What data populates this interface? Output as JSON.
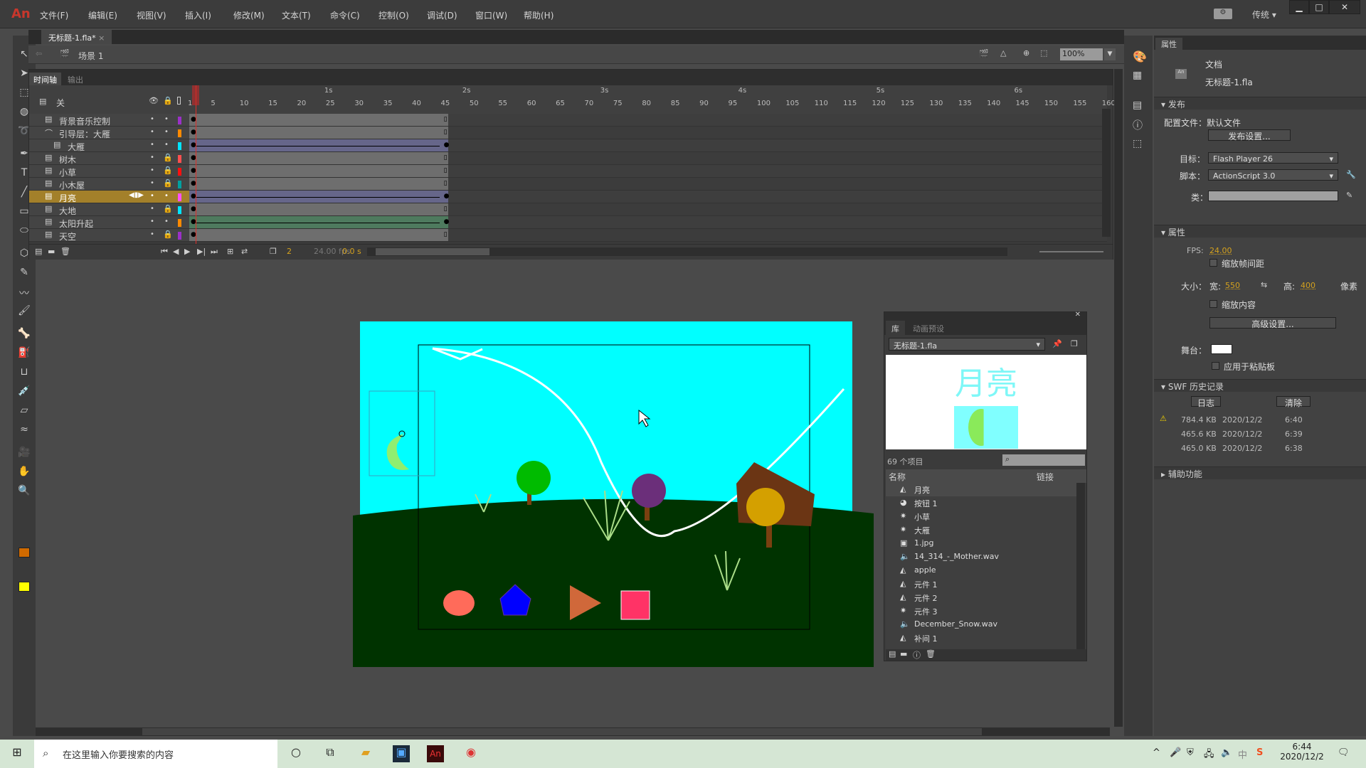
{
  "app": {
    "logo": "An",
    "menus": [
      "文件(F)",
      "编辑(E)",
      "视图(V)",
      "插入(I)",
      "修改(M)",
      "文本(T)",
      "命令(C)",
      "控制(O)",
      "调试(D)",
      "窗口(W)",
      "帮助(H)"
    ],
    "workspace": "传统",
    "win_min": "▁",
    "win_max": "□",
    "win_close": "✕"
  },
  "doc_tab": {
    "title": "无标题-1.fla*",
    "close": "×"
  },
  "scene": {
    "label": "场景 1",
    "zoom": "100%"
  },
  "timeline": {
    "tabs": [
      "时间轴",
      "输出"
    ],
    "header": "关",
    "ruler_seconds": [
      "1s",
      "2s",
      "3s",
      "4s",
      "5s",
      "6s"
    ],
    "fps_frames": 24,
    "max_frame": 160,
    "layers": [
      {
        "name": "背景音乐控制",
        "color": "#9b30c8",
        "locked": false,
        "tween": null,
        "indent": 0,
        "icon": "layer"
      },
      {
        "name": "引导层：大雁",
        "color": "#ff8a00",
        "locked": false,
        "tween": null,
        "indent": 0,
        "icon": "guide"
      },
      {
        "name": "大雁",
        "color": "#00e5ff",
        "locked": false,
        "tween": "#66668a",
        "indent": 1,
        "icon": "layer"
      },
      {
        "name": "树木",
        "color": "#ff5050",
        "locked": true,
        "tween": null,
        "indent": 0,
        "icon": "layer"
      },
      {
        "name": "小草",
        "color": "#ff1010",
        "locked": true,
        "tween": null,
        "indent": 0,
        "icon": "layer"
      },
      {
        "name": "小木屋",
        "color": "#00a0a0",
        "locked": true,
        "tween": null,
        "indent": 0,
        "icon": "layer"
      },
      {
        "name": "月亮",
        "color": "#ff50ff",
        "locked": false,
        "tween": "#66668a",
        "indent": 0,
        "icon": "layer",
        "selected": true
      },
      {
        "name": "大地",
        "color": "#00e5ff",
        "locked": true,
        "tween": null,
        "indent": 0,
        "icon": "layer"
      },
      {
        "name": "太阳升起",
        "color": "#ff8a00",
        "locked": false,
        "tween": "#4e7a5e",
        "indent": 0,
        "icon": "layer"
      },
      {
        "name": "天空",
        "color": "#9b30c8",
        "locked": true,
        "tween": null,
        "indent": 0,
        "icon": "layer"
      }
    ],
    "current_frame": "2",
    "fps": "24.00 fps",
    "time": "0.0 s",
    "last_frame": 45
  },
  "library": {
    "tabs": [
      "库",
      "动画预设"
    ],
    "file": "无标题-1.fla",
    "preview_title": "月亮",
    "count": "69 个项目",
    "col_name": "名称",
    "col_link": "链接",
    "items": [
      {
        "name": "月亮",
        "icon": "graphic"
      },
      {
        "name": "按钮 1",
        "icon": "button"
      },
      {
        "name": "小草",
        "icon": "movieclip"
      },
      {
        "name": "大雁",
        "icon": "movieclip"
      },
      {
        "name": "1.jpg",
        "icon": "bitmap"
      },
      {
        "name": "14_314_-_Mother.wav",
        "icon": "sound"
      },
      {
        "name": "apple",
        "icon": "graphic"
      },
      {
        "name": "元件 1",
        "icon": "graphic"
      },
      {
        "name": "元件 2",
        "icon": "graphic"
      },
      {
        "name": "元件 3",
        "icon": "movieclip"
      },
      {
        "name": "December_Snow.wav",
        "icon": "sound"
      },
      {
        "name": "补间 1",
        "icon": "graphic"
      }
    ]
  },
  "props": {
    "tab": "属性",
    "doc_type": "文档",
    "doc_name": "无标题-1.fla",
    "publish": {
      "title": "发布",
      "profile_label": "配置文件：",
      "profile": "默认文件",
      "settings_btn": "发布设置...",
      "target_label": "目标：",
      "target": "Flash Player 26",
      "script_label": "脚本：",
      "script": "ActionScript 3.0",
      "class_label": "类："
    },
    "attributes": {
      "title": "属性",
      "fps_label": "FPS:",
      "fps": "24.00",
      "scale_spans": "缩放帧间距",
      "size_label": "大小：",
      "w_label": "宽:",
      "w": "550",
      "h_label": "高:",
      "h": "400",
      "unit": "像素",
      "scale_content": "缩放内容",
      "advanced_btn": "高级设置...",
      "stage_label": "舞台：",
      "stage_color": "#ffffff",
      "apply_paste": "应用于粘贴板"
    },
    "swf": {
      "title": "SWF 历史记录",
      "log_btn": "日志",
      "clear_btn": "清除",
      "rows": [
        {
          "size": "784.4 KB",
          "date": "2020/12/2",
          "time": "6:40",
          "warn": true
        },
        {
          "size": "465.6 KB",
          "date": "2020/12/2",
          "time": "6:39"
        },
        {
          "size": "465.0 KB",
          "date": "2020/12/2",
          "time": "6:38"
        }
      ]
    },
    "accessibility": "辅助功能"
  },
  "taskbar": {
    "search_placeholder": "在这里输入你要搜索的内容",
    "time": "6:44",
    "date": "2020/12/2",
    "ime": "中"
  }
}
